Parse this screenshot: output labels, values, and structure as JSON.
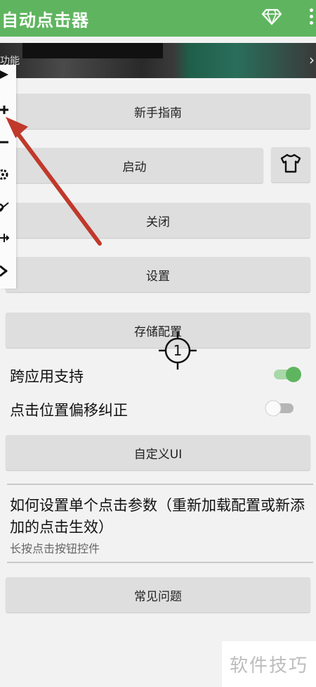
{
  "app": {
    "title": "自动点击器"
  },
  "banner": {
    "caption": "功能",
    "chevron": "›"
  },
  "buttons": {
    "guide": "新手指南",
    "start": "启动",
    "close": "关闭",
    "settings": "设置",
    "save_config": "存储配置",
    "custom_ui": "自定义UI",
    "faq": "常见问题"
  },
  "toggles": {
    "cross_app": {
      "label": "跨应用支持",
      "on": true
    },
    "offset": {
      "label": "点击位置偏移纠正",
      "on": false
    }
  },
  "howto": {
    "title": "如何设置单个点击参数（重新加载配置或新添加的点击生效）",
    "subtitle": "长按点击按钮控件"
  },
  "crosshair": {
    "label": "1"
  },
  "watermark": {
    "text": "软件技巧"
  },
  "icons": {
    "toolbar": [
      "play-icon",
      "plus-icon",
      "minus-icon",
      "gear-icon",
      "eye-off-icon",
      "move-icon",
      "close-icon"
    ],
    "header": [
      "diamond-icon",
      "more-vert-icon"
    ]
  },
  "colors": {
    "appbar": "#5fb55f",
    "toggle_on": "#5fb55f",
    "arrow": "#c0392b"
  }
}
